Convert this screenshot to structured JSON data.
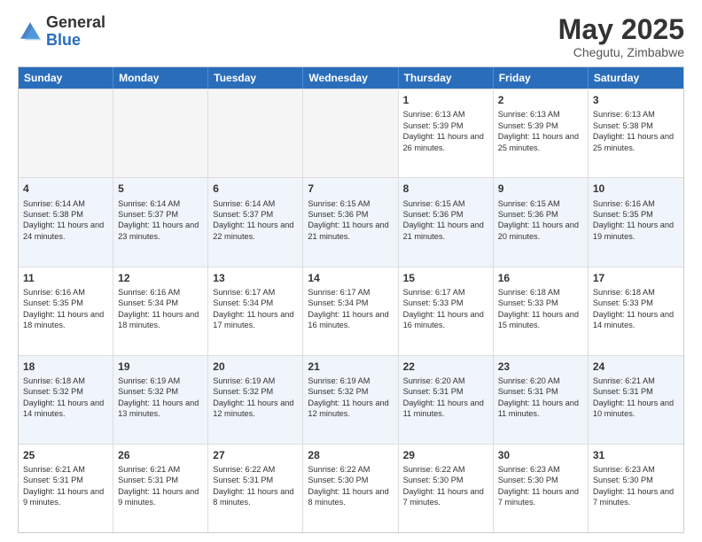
{
  "header": {
    "logo_general": "General",
    "logo_blue": "Blue",
    "month_title": "May 2025",
    "location": "Chegutu, Zimbabwe"
  },
  "days_of_week": [
    "Sunday",
    "Monday",
    "Tuesday",
    "Wednesday",
    "Thursday",
    "Friday",
    "Saturday"
  ],
  "rows": [
    {
      "alt": false,
      "cells": [
        {
          "day": "",
          "info": "",
          "empty": true
        },
        {
          "day": "",
          "info": "",
          "empty": true
        },
        {
          "day": "",
          "info": "",
          "empty": true
        },
        {
          "day": "",
          "info": "",
          "empty": true
        },
        {
          "day": "1",
          "info": "Sunrise: 6:13 AM\nSunset: 5:39 PM\nDaylight: 11 hours and 26 minutes.",
          "empty": false
        },
        {
          "day": "2",
          "info": "Sunrise: 6:13 AM\nSunset: 5:39 PM\nDaylight: 11 hours and 25 minutes.",
          "empty": false
        },
        {
          "day": "3",
          "info": "Sunrise: 6:13 AM\nSunset: 5:38 PM\nDaylight: 11 hours and 25 minutes.",
          "empty": false
        }
      ]
    },
    {
      "alt": true,
      "cells": [
        {
          "day": "4",
          "info": "Sunrise: 6:14 AM\nSunset: 5:38 PM\nDaylight: 11 hours and 24 minutes.",
          "empty": false
        },
        {
          "day": "5",
          "info": "Sunrise: 6:14 AM\nSunset: 5:37 PM\nDaylight: 11 hours and 23 minutes.",
          "empty": false
        },
        {
          "day": "6",
          "info": "Sunrise: 6:14 AM\nSunset: 5:37 PM\nDaylight: 11 hours and 22 minutes.",
          "empty": false
        },
        {
          "day": "7",
          "info": "Sunrise: 6:15 AM\nSunset: 5:36 PM\nDaylight: 11 hours and 21 minutes.",
          "empty": false
        },
        {
          "day": "8",
          "info": "Sunrise: 6:15 AM\nSunset: 5:36 PM\nDaylight: 11 hours and 21 minutes.",
          "empty": false
        },
        {
          "day": "9",
          "info": "Sunrise: 6:15 AM\nSunset: 5:36 PM\nDaylight: 11 hours and 20 minutes.",
          "empty": false
        },
        {
          "day": "10",
          "info": "Sunrise: 6:16 AM\nSunset: 5:35 PM\nDaylight: 11 hours and 19 minutes.",
          "empty": false
        }
      ]
    },
    {
      "alt": false,
      "cells": [
        {
          "day": "11",
          "info": "Sunrise: 6:16 AM\nSunset: 5:35 PM\nDaylight: 11 hours and 18 minutes.",
          "empty": false
        },
        {
          "day": "12",
          "info": "Sunrise: 6:16 AM\nSunset: 5:34 PM\nDaylight: 11 hours and 18 minutes.",
          "empty": false
        },
        {
          "day": "13",
          "info": "Sunrise: 6:17 AM\nSunset: 5:34 PM\nDaylight: 11 hours and 17 minutes.",
          "empty": false
        },
        {
          "day": "14",
          "info": "Sunrise: 6:17 AM\nSunset: 5:34 PM\nDaylight: 11 hours and 16 minutes.",
          "empty": false
        },
        {
          "day": "15",
          "info": "Sunrise: 6:17 AM\nSunset: 5:33 PM\nDaylight: 11 hours and 16 minutes.",
          "empty": false
        },
        {
          "day": "16",
          "info": "Sunrise: 6:18 AM\nSunset: 5:33 PM\nDaylight: 11 hours and 15 minutes.",
          "empty": false
        },
        {
          "day": "17",
          "info": "Sunrise: 6:18 AM\nSunset: 5:33 PM\nDaylight: 11 hours and 14 minutes.",
          "empty": false
        }
      ]
    },
    {
      "alt": true,
      "cells": [
        {
          "day": "18",
          "info": "Sunrise: 6:18 AM\nSunset: 5:32 PM\nDaylight: 11 hours and 14 minutes.",
          "empty": false
        },
        {
          "day": "19",
          "info": "Sunrise: 6:19 AM\nSunset: 5:32 PM\nDaylight: 11 hours and 13 minutes.",
          "empty": false
        },
        {
          "day": "20",
          "info": "Sunrise: 6:19 AM\nSunset: 5:32 PM\nDaylight: 11 hours and 12 minutes.",
          "empty": false
        },
        {
          "day": "21",
          "info": "Sunrise: 6:19 AM\nSunset: 5:32 PM\nDaylight: 11 hours and 12 minutes.",
          "empty": false
        },
        {
          "day": "22",
          "info": "Sunrise: 6:20 AM\nSunset: 5:31 PM\nDaylight: 11 hours and 11 minutes.",
          "empty": false
        },
        {
          "day": "23",
          "info": "Sunrise: 6:20 AM\nSunset: 5:31 PM\nDaylight: 11 hours and 11 minutes.",
          "empty": false
        },
        {
          "day": "24",
          "info": "Sunrise: 6:21 AM\nSunset: 5:31 PM\nDaylight: 11 hours and 10 minutes.",
          "empty": false
        }
      ]
    },
    {
      "alt": false,
      "cells": [
        {
          "day": "25",
          "info": "Sunrise: 6:21 AM\nSunset: 5:31 PM\nDaylight: 11 hours and 9 minutes.",
          "empty": false
        },
        {
          "day": "26",
          "info": "Sunrise: 6:21 AM\nSunset: 5:31 PM\nDaylight: 11 hours and 9 minutes.",
          "empty": false
        },
        {
          "day": "27",
          "info": "Sunrise: 6:22 AM\nSunset: 5:31 PM\nDaylight: 11 hours and 8 minutes.",
          "empty": false
        },
        {
          "day": "28",
          "info": "Sunrise: 6:22 AM\nSunset: 5:30 PM\nDaylight: 11 hours and 8 minutes.",
          "empty": false
        },
        {
          "day": "29",
          "info": "Sunrise: 6:22 AM\nSunset: 5:30 PM\nDaylight: 11 hours and 7 minutes.",
          "empty": false
        },
        {
          "day": "30",
          "info": "Sunrise: 6:23 AM\nSunset: 5:30 PM\nDaylight: 11 hours and 7 minutes.",
          "empty": false
        },
        {
          "day": "31",
          "info": "Sunrise: 6:23 AM\nSunset: 5:30 PM\nDaylight: 11 hours and 7 minutes.",
          "empty": false
        }
      ]
    }
  ]
}
